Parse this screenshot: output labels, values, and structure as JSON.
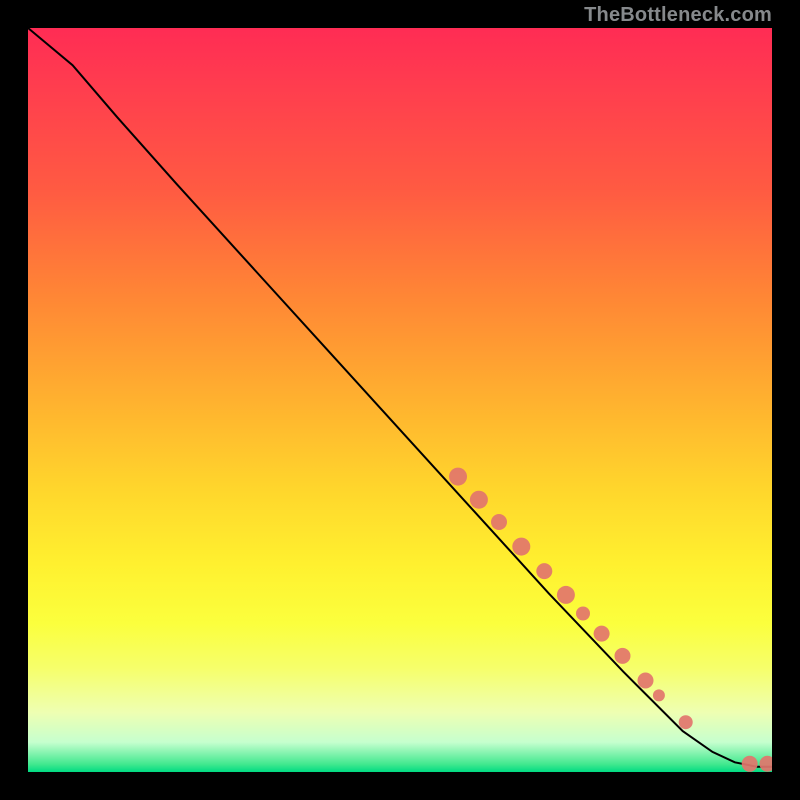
{
  "watermark": "TheBottleneck.com",
  "chart_data": {
    "type": "line",
    "title": "",
    "xlabel": "",
    "ylabel": "",
    "xlim": [
      0,
      100
    ],
    "ylim": [
      0,
      100
    ],
    "curve": [
      {
        "x": 0,
        "y": 100
      },
      {
        "x": 6,
        "y": 95
      },
      {
        "x": 12,
        "y": 88
      },
      {
        "x": 20,
        "y": 79
      },
      {
        "x": 30,
        "y": 68
      },
      {
        "x": 40,
        "y": 57
      },
      {
        "x": 50,
        "y": 46
      },
      {
        "x": 60,
        "y": 35
      },
      {
        "x": 70,
        "y": 24
      },
      {
        "x": 80,
        "y": 13.5
      },
      {
        "x": 88,
        "y": 5.5
      },
      {
        "x": 92,
        "y": 2.7
      },
      {
        "x": 95,
        "y": 1.3
      },
      {
        "x": 98,
        "y": 0.7
      },
      {
        "x": 100,
        "y": 0.7
      }
    ],
    "scatter_clusters": [
      {
        "x": 57.8,
        "y": 39.7,
        "r": 9,
        "n": 3
      },
      {
        "x": 60.6,
        "y": 36.6,
        "r": 9,
        "n": 3
      },
      {
        "x": 63.3,
        "y": 33.6,
        "r": 8,
        "n": 2
      },
      {
        "x": 66.3,
        "y": 30.3,
        "r": 9,
        "n": 3
      },
      {
        "x": 69.4,
        "y": 27.0,
        "r": 8,
        "n": 2
      },
      {
        "x": 72.3,
        "y": 23.8,
        "r": 9,
        "n": 3
      },
      {
        "x": 74.6,
        "y": 21.3,
        "r": 7,
        "n": 1
      },
      {
        "x": 77.1,
        "y": 18.6,
        "r": 8,
        "n": 2
      },
      {
        "x": 79.9,
        "y": 15.6,
        "r": 8,
        "n": 2
      },
      {
        "x": 83.0,
        "y": 12.3,
        "r": 8,
        "n": 2
      },
      {
        "x": 84.8,
        "y": 10.3,
        "r": 6,
        "n": 1
      },
      {
        "x": 88.4,
        "y": 6.7,
        "r": 7,
        "n": 1
      },
      {
        "x": 97.0,
        "y": 1.1,
        "r": 8,
        "n": 1
      },
      {
        "x": 99.4,
        "y": 1.1,
        "r": 8,
        "n": 1
      }
    ],
    "scatter_color": "#e2756c",
    "curve_color": "#000000"
  }
}
